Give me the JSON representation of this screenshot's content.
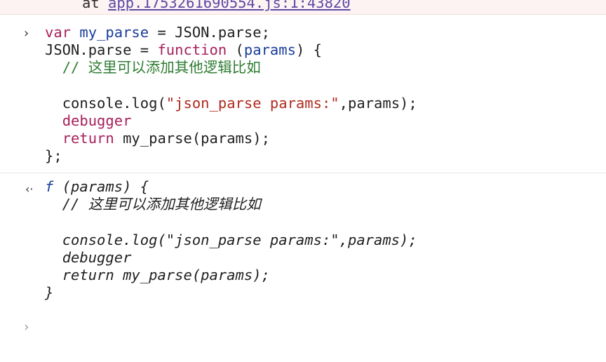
{
  "error": {
    "prefix": "at",
    "link": "app.1753261690554.js:1:43820"
  },
  "input": {
    "prompt_icon": "›",
    "line1": {
      "kw": "var",
      "name": "my_parse",
      "rest": " = JSON.parse;"
    },
    "line2": {
      "lhs": "JSON.parse = ",
      "kw": "function",
      "open": " (",
      "param": "params",
      "close": ") {"
    },
    "line3": {
      "comment": "// 这里可以添加其他逻辑比如"
    },
    "line4": "",
    "line5": {
      "pre": "console.log(",
      "str": "\"json_parse params:\"",
      "post": ",params);"
    },
    "line6": {
      "kw": "debugger"
    },
    "line7": {
      "kw": "return",
      "rest": " my_parse(params);"
    },
    "line8": "};"
  },
  "output": {
    "result_icon": "‹·",
    "line1": {
      "f": "f",
      "rest": " (params) {"
    },
    "line2": "// 这里可以添加其他逻辑比如",
    "line3": "",
    "line4": "console.log(\"json_parse params:\",params);",
    "line5": "debugger",
    "line6": "return my_parse(params);",
    "line7": "}"
  },
  "prompt": {
    "icon": "›",
    "value": ""
  }
}
